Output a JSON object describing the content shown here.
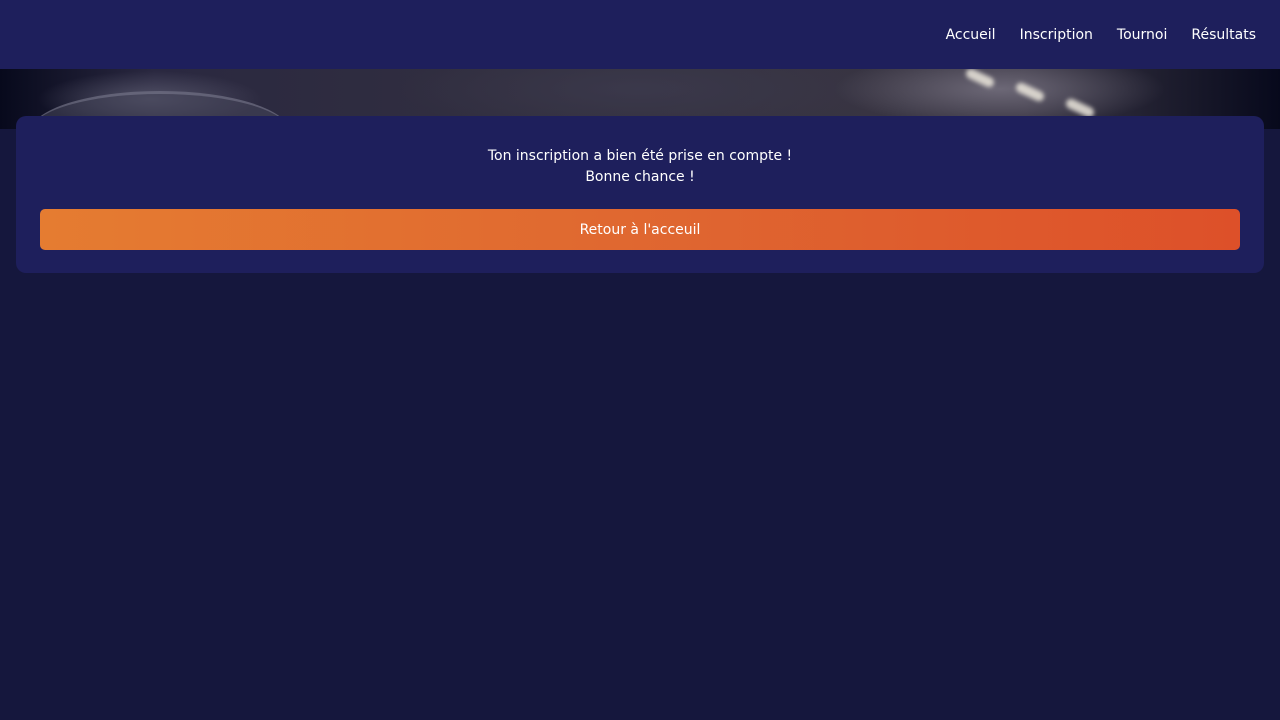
{
  "nav": {
    "items": [
      {
        "label": "Accueil"
      },
      {
        "label": "Inscription"
      },
      {
        "label": "Tournoi"
      },
      {
        "label": "Résultats"
      }
    ]
  },
  "confirmation": {
    "line1": "Ton inscription a bien été prise en compte !",
    "line2": "Bonne chance !",
    "button_label": "Retour à l'acceuil"
  },
  "colors": {
    "page_background": "#15173d",
    "navbar_background": "#1e1f5c",
    "card_background": "#1e1f5c",
    "button_gradient_start": "#e57c31",
    "button_gradient_end": "#dd5029",
    "text": "#ffffff"
  }
}
